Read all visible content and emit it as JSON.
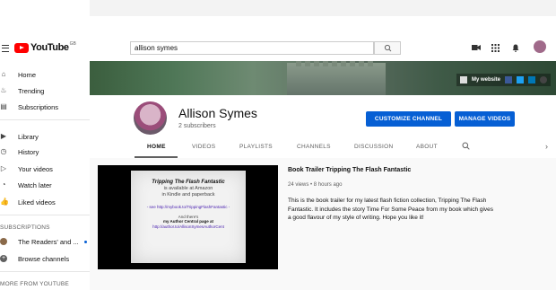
{
  "masthead": {
    "logo_text": "YouTube",
    "logo_country": "GB",
    "search_value": "allison symes"
  },
  "sidebar": {
    "items": [
      {
        "label": "Home",
        "icon": "home-icon"
      },
      {
        "label": "Trending",
        "icon": "flame-icon"
      },
      {
        "label": "Subscriptions",
        "icon": "subscriptions-icon"
      },
      {
        "label": "Library",
        "icon": "library-icon"
      },
      {
        "label": "History",
        "icon": "history-icon"
      },
      {
        "label": "Your videos",
        "icon": "play-icon"
      },
      {
        "label": "Watch later",
        "icon": "clock-icon"
      },
      {
        "label": "Liked videos",
        "icon": "thumbs-up-icon"
      }
    ],
    "subscriptions_heading": "SUBSCRIPTIONS",
    "subscriptions": [
      {
        "label": "The Readers' and ...",
        "icon": "avatar-icon"
      },
      {
        "label": "Browse channels",
        "icon": "plus-circle-icon"
      }
    ],
    "more_heading": "MORE FROM YOUTUBE"
  },
  "banner": {
    "link_label": "My website"
  },
  "channel": {
    "name": "Allison Symes",
    "subscribers": "2 subscribers",
    "customize_label": "CUSTOMIZE CHANNEL",
    "manage_label": "MANAGE VIDEOS"
  },
  "tabs": [
    "HOME",
    "VIDEOS",
    "PLAYLISTS",
    "CHANNELS",
    "DISCUSSION",
    "ABOUT"
  ],
  "video": {
    "thumb_title": "Tripping The Flash Fantastic",
    "thumb_line2": "is available at Amazon",
    "thumb_line3": "in Kindle and paperback",
    "thumb_link1": "- see http://mybook.to/TrippingFlashFantastic -",
    "thumb_and": "And there's",
    "thumb_author": "my Author Central page at",
    "thumb_link2": "http://author.to/AllisonSymesAuthorCent",
    "title": "Book Trailer Tripping The Flash Fantastic",
    "meta": "24 views • 8 hours ago",
    "description": "This is the book trailer for my latest flash fiction collection, Tripping The Flash Fantastic. It includes the story Time For Some Peace from my book which gives a good flavour of my style of writing. Hope you like it!"
  },
  "colors": {
    "accent": "#065fd4",
    "brand": "#ff0000"
  }
}
